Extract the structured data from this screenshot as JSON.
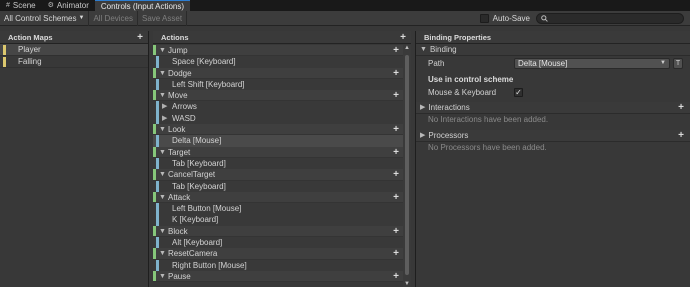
{
  "tabs": [
    {
      "label": "Scene",
      "icon": "hash-icon"
    },
    {
      "label": "Animator",
      "icon": "animator-icon"
    },
    {
      "label": "Controls (Input Actions)",
      "icon": ""
    }
  ],
  "toolbar": {
    "control_schemes": "All Control Schemes",
    "all_devices": "All Devices",
    "save_asset": "Save Asset",
    "auto_save": "Auto-Save",
    "search_placeholder": ""
  },
  "maps": {
    "title": "Action Maps",
    "items": [
      {
        "label": "Player",
        "selected": true
      },
      {
        "label": "Falling",
        "selected": false
      }
    ]
  },
  "actions": {
    "title": "Actions",
    "rows": [
      {
        "kind": "action",
        "label": "Jump"
      },
      {
        "kind": "binding",
        "label": "Space [Keyboard]"
      },
      {
        "kind": "action",
        "label": "Dodge"
      },
      {
        "kind": "binding",
        "label": "Left Shift [Keyboard]"
      },
      {
        "kind": "action",
        "label": "Move"
      },
      {
        "kind": "composite",
        "label": "Arrows"
      },
      {
        "kind": "composite",
        "label": "WASD"
      },
      {
        "kind": "action",
        "label": "Look"
      },
      {
        "kind": "binding",
        "label": "Delta [Mouse]",
        "selected": true
      },
      {
        "kind": "action",
        "label": "Target"
      },
      {
        "kind": "binding",
        "label": "Tab [Keyboard]"
      },
      {
        "kind": "action",
        "label": "CancelTarget"
      },
      {
        "kind": "binding",
        "label": "Tab [Keyboard]"
      },
      {
        "kind": "action",
        "label": "Attack"
      },
      {
        "kind": "binding",
        "label": "Left Button [Mouse]"
      },
      {
        "kind": "binding",
        "label": "K [Keyboard]"
      },
      {
        "kind": "action",
        "label": "Block"
      },
      {
        "kind": "binding",
        "label": "Alt [Keyboard]"
      },
      {
        "kind": "action",
        "label": "ResetCamera"
      },
      {
        "kind": "binding",
        "label": "Right Button [Mouse]"
      },
      {
        "kind": "action",
        "label": "Pause"
      }
    ]
  },
  "props": {
    "title": "Binding Properties",
    "binding_section": "Binding",
    "path_label": "Path",
    "path_value": "Delta [Mouse]",
    "t_button": "T",
    "use_in_scheme": "Use in control scheme",
    "scheme_name": "Mouse & Keyboard",
    "scheme_checked": "✓",
    "interactions_title": "Interactions",
    "interactions_empty": "No Interactions have been added.",
    "processors_title": "Processors",
    "processors_empty": "No Processors have been added."
  },
  "colors": {
    "map_bar": "#dcc86e",
    "action_bar": "#86c77a",
    "binding_bar": "#7fb3cc",
    "tab_accent": "#2d7dd0"
  }
}
